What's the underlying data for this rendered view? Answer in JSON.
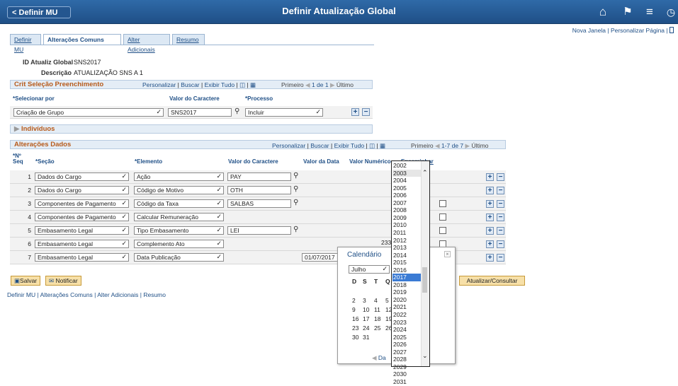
{
  "header": {
    "back_label": "Definir MU",
    "title": "Definir Atualização Global",
    "icons": [
      "home-icon",
      "flag-icon",
      "menu-icon",
      "nav-icon"
    ]
  },
  "toplinks": {
    "new_window": "Nova Janela",
    "sep": "|",
    "personalize": "Personalizar Página",
    "extra": "|"
  },
  "tabs": [
    "Definir MU",
    "Alterações Comuns",
    "Alter Adicionais",
    "Resumo"
  ],
  "info": {
    "id_label": "ID Atualiz Global",
    "id_value": "SNS2017",
    "desc_label": "Descrição",
    "desc_value": "ATUALIZAÇÃO SNS A 1"
  },
  "crit": {
    "title": "Crit Seleção Preenchimento",
    "nav": {
      "personalize": "Personalizar",
      "find": "Buscar",
      "view_all": "Exibir Tudo",
      "first": "Primeiro",
      "range": "1 de 1",
      "last": "Último"
    },
    "cols": [
      "*Selecionar por",
      "Valor do Caractere",
      "*Processo"
    ],
    "row": {
      "select_by": "Criação de Grupo",
      "value": "SNS2017",
      "process": "Incluir"
    }
  },
  "individuos": "Indivíduos",
  "alter": {
    "title": "Alterações Dados",
    "nav": {
      "personalize": "Personalizar",
      "find": "Buscar",
      "view_all": "Exibir Tudo",
      "first": "Primeiro",
      "range": "1-7 de 7",
      "last": "Último"
    },
    "cols": [
      "*Nº Seq",
      "*Seção",
      "*Elemento",
      "Valor do Caractere",
      "Valor da Data",
      "Valor Numérico",
      "Encaminhar"
    ],
    "rows": [
      {
        "seq": "1",
        "secao": "Dados do Cargo",
        "elemento": "Ação",
        "char": "PAY",
        "date": "",
        "num": "",
        "fwd": false,
        "cb": false
      },
      {
        "seq": "2",
        "secao": "Dados do Cargo",
        "elemento": "Código de Motivo",
        "char": "OTH",
        "date": "",
        "num": "",
        "fwd": false,
        "cb": false
      },
      {
        "seq": "3",
        "secao": "Componentes de Pagamento",
        "elemento": "Código da Taxa",
        "char": "SALBAS",
        "date": "",
        "num": "",
        "fwd": true,
        "cb": true
      },
      {
        "seq": "4",
        "secao": "Componentes de Pagamento",
        "elemento": "Calcular Remuneração",
        "char": "",
        "date": "",
        "num": "",
        "fwd": true,
        "cb": true
      },
      {
        "seq": "5",
        "secao": "Embasamento Legal",
        "elemento": "Tipo Embasamento",
        "char": "LEI",
        "date": "",
        "num": "",
        "fwd": true,
        "cb": true
      },
      {
        "seq": "6",
        "secao": "Embasamento Legal",
        "elemento": "Complemento Ato",
        "char": "",
        "date": "",
        "num": "233",
        "fwd": true,
        "cb": true
      },
      {
        "seq": "7",
        "secao": "Embasamento Legal",
        "elemento": "Data Publicação",
        "char": "",
        "date": "01/07/2017",
        "num": "",
        "fwd": false,
        "cb": false
      }
    ]
  },
  "buttons": {
    "save": "Salvar",
    "notify": "Notificar",
    "update": "Atualizar/Consultar"
  },
  "bottom_links": [
    "Definir MU",
    "Alterações Comuns",
    "Alter Adicionais",
    "Resumo"
  ],
  "calendar": {
    "title": "Calendário",
    "close": "×",
    "month": "Julho",
    "weekdays": [
      "D",
      "S",
      "T",
      "Q"
    ],
    "weeks": [
      [
        "",
        "",
        "",
        ""
      ],
      [
        "2",
        "3",
        "4",
        "5"
      ],
      [
        "9",
        "10",
        "11",
        "12"
      ],
      [
        "16",
        "17",
        "18",
        "19"
      ],
      [
        "23",
        "24",
        "25",
        "26"
      ],
      [
        "30",
        "31",
        "",
        ""
      ]
    ],
    "footer": "Da"
  },
  "years": {
    "list": [
      "2002",
      "2003",
      "2004",
      "2005",
      "2006",
      "2007",
      "2008",
      "2009",
      "2010",
      "2011",
      "2012",
      "2013",
      "2014",
      "2015",
      "2016",
      "2017",
      "2018",
      "2019",
      "2020",
      "2021",
      "2022",
      "2023",
      "2024",
      "2025",
      "2026",
      "2027",
      "2028",
      "2029",
      "2030",
      "2031"
    ],
    "selected": "2017",
    "hover": "2003"
  }
}
